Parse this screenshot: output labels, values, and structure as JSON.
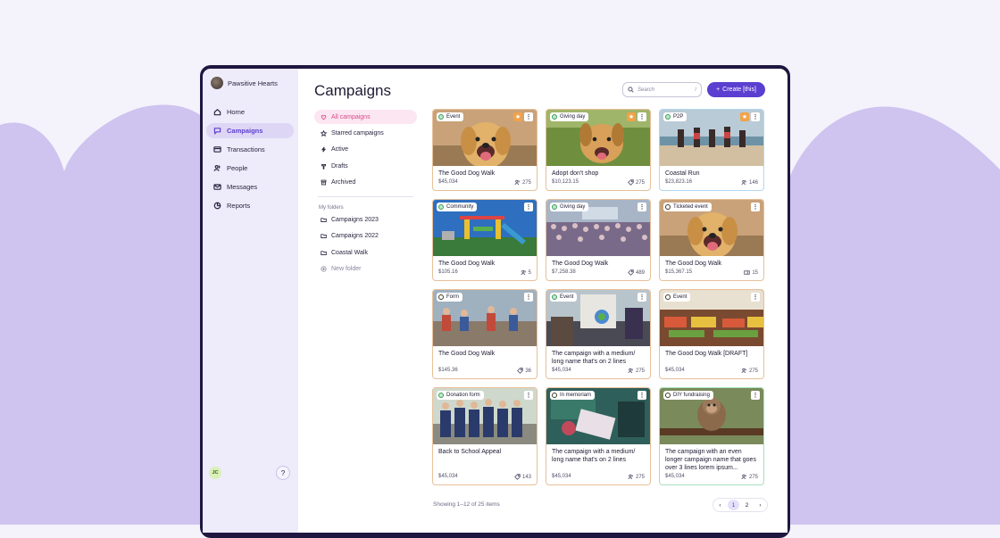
{
  "org": {
    "name": "Pawsitive Hearts"
  },
  "nav": [
    {
      "label": "Home",
      "icon": "home-icon",
      "active": false
    },
    {
      "label": "Campaigns",
      "icon": "megaphone-icon",
      "active": true
    },
    {
      "label": "Transactions",
      "icon": "card-icon",
      "active": false
    },
    {
      "label": "People",
      "icon": "people-icon",
      "active": false
    },
    {
      "label": "Messages",
      "icon": "mail-icon",
      "active": false
    },
    {
      "label": "Reports",
      "icon": "pie-icon",
      "active": false
    }
  ],
  "user": {
    "initials": "JC"
  },
  "help": {
    "label": "?"
  },
  "page": {
    "title": "Campaigns"
  },
  "search": {
    "placeholder": "Search",
    "shortcut": "/"
  },
  "create": {
    "label": "Create [this]"
  },
  "filters": [
    {
      "label": "All campaigns",
      "active": true
    },
    {
      "label": "Starred campaigns",
      "active": false
    },
    {
      "label": "Active",
      "active": false
    },
    {
      "label": "Drafts",
      "active": false
    },
    {
      "label": "Archived",
      "active": false
    }
  ],
  "folders": {
    "heading": "My folders",
    "items": [
      "Campaigns 2023",
      "Campaigns 2022",
      "Coastal Walk"
    ],
    "new": "New folder"
  },
  "cards": [
    {
      "type": "Event",
      "status": "active",
      "starred": true,
      "name": "The Good Dog Walk",
      "amount": "$45,034",
      "count": "275",
      "count_icon": "people",
      "color": "orange",
      "scene": "dog"
    },
    {
      "type": "Giving day",
      "status": "active",
      "starred": true,
      "name": "Adopt don't shop",
      "amount": "$10,123.15",
      "count": "275",
      "count_icon": "tag",
      "color": "orange",
      "scene": "dog2"
    },
    {
      "type": "P2P",
      "status": "active",
      "starred": true,
      "name": "Coastal Run",
      "amount": "$23,823.16",
      "count": "146",
      "count_icon": "people",
      "color": "blue",
      "scene": "beach"
    },
    {
      "type": "Community",
      "status": "active",
      "starred": false,
      "name": "The Good Dog Walk",
      "amount": "$105.16",
      "count": "5",
      "count_icon": "people",
      "color": "orange",
      "scene": "playground"
    },
    {
      "type": "Giving day",
      "status": "active",
      "starred": false,
      "name": "The Good Dog Walk",
      "amount": "$7,258.38",
      "count": "489",
      "count_icon": "tag",
      "color": "orange",
      "scene": "crowd"
    },
    {
      "type": "Ticketed event",
      "status": "draft",
      "starred": false,
      "name": "The Good Dog Walk",
      "amount": "$15,367.15",
      "count": "15",
      "count_icon": "ticket",
      "color": "orange",
      "scene": "dog"
    },
    {
      "type": "Form",
      "status": "draft",
      "starred": false,
      "name": "The Good Dog Walk",
      "amount": "$145.36",
      "count": "36",
      "count_icon": "tag",
      "color": "orange",
      "scene": "classroom"
    },
    {
      "type": "Event",
      "status": "active",
      "starred": false,
      "name": "The campaign with a medium/ long name that's on 2 lines",
      "amount": "$45,034",
      "count": "275",
      "count_icon": "people",
      "color": "orange",
      "scene": "protest"
    },
    {
      "type": "Event",
      "status": "draft",
      "starred": false,
      "name": "The Good Dog Walk [DRAFT]",
      "amount": "$45,034",
      "count": "275",
      "count_icon": "people",
      "color": "orange",
      "scene": "market"
    },
    {
      "type": "Donation form",
      "status": "active",
      "starred": false,
      "name": "Back to School Appeal",
      "amount": "$45,034",
      "count": "143",
      "count_icon": "tag",
      "color": "orange",
      "scene": "kids"
    },
    {
      "type": "In memoriam",
      "status": "draft",
      "starred": false,
      "name": "The campaign with a medium/ long name that's on 2 lines",
      "amount": "$45,034",
      "count": "275",
      "count_icon": "people",
      "color": "orange",
      "scene": "protest2"
    },
    {
      "type": "DIY fundraising",
      "status": "draft",
      "starred": false,
      "name": "The campaign with an even longer campaign name that goes over 3 lines lorem ipsum...",
      "amount": "$45,034",
      "count": "275",
      "count_icon": "people",
      "color": "green",
      "scene": "monkey"
    }
  ],
  "pagination": {
    "summary": "Showing 1–12 of 25 items",
    "pages": [
      "1",
      "2"
    ],
    "current": "1",
    "prev": "‹",
    "next": "›"
  }
}
